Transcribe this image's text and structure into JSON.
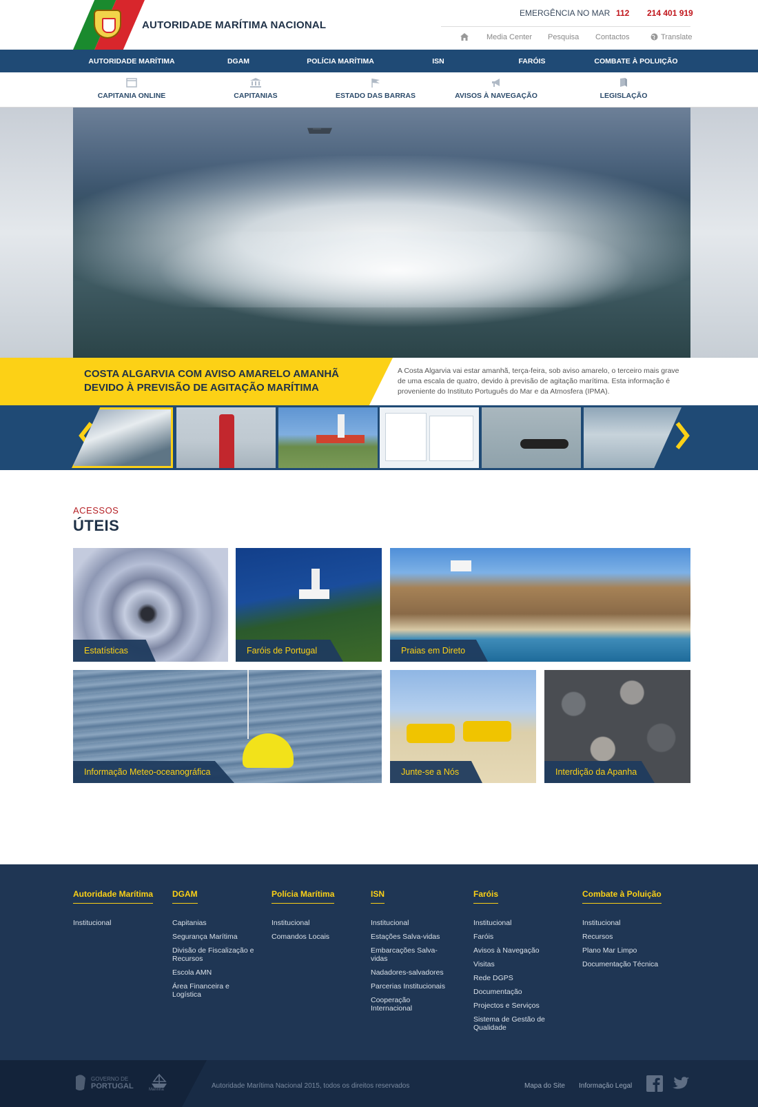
{
  "header": {
    "site_title": "AUTORIDADE MARÍTIMA NACIONAL",
    "emergency_label": "EMERGÊNCIA NO MAR",
    "emergency_number": "112",
    "emergency_phone": "214 401 919",
    "links": [
      "Media Center",
      "Pesquisa",
      "Contactos",
      "Translate"
    ]
  },
  "main_nav": [
    "AUTORIDADE MARÍTIMA",
    "DGAM",
    "POLÍCIA MARÍTIMA",
    "ISN",
    "FARÓIS",
    "COMBATE À POLUIÇÃO"
  ],
  "sub_nav": [
    {
      "label": "CAPITANIA ONLINE",
      "icon": "browser-window-icon"
    },
    {
      "label": "CAPITANIAS",
      "icon": "institution-building-icon"
    },
    {
      "label": "ESTADO DAS BARRAS",
      "icon": "flag-icon"
    },
    {
      "label": "AVISOS À NAVEGAÇÃO",
      "icon": "megaphone-icon"
    },
    {
      "label": "LEGISLAÇÃO",
      "icon": "book-icon"
    }
  ],
  "hero": {
    "headline_line1": "COSTA ALGARVIA COM AVISO AMARELO AMANHÃ",
    "headline_line2": "DEVIDO À PREVISÃO DE AGITAÇÃO MARÍTIMA",
    "description": "A Costa Algarvia vai estar amanhã, terça-feira, sob aviso amarelo, o terceiro mais grave de uma escala de quatro, devido à previsão de agitação marítima. Esta informação é proveniente do Instituto Português do Mar e da Atmosfera (IPMA)."
  },
  "carousel": {
    "thumbnails": [
      "wave-thumbnail",
      "red-buoy-thumbnail",
      "lighthouse-thumbnail",
      "website-screens-thumbnail",
      "rib-boat-thumbnail",
      "fog-ship-helicopter-thumbnail"
    ],
    "active_index": 0
  },
  "section": {
    "kicker": "ACESSOS",
    "title": "ÚTEIS"
  },
  "tiles": [
    "Estatísticas",
    "Faróis de Portugal",
    "Praias em Direto",
    "Informação Meteo-oceanográfica",
    "Junte-se a Nós",
    "Interdição da Apanha"
  ],
  "footer": {
    "columns": [
      {
        "heading": "Autoridade Marítima",
        "links": [
          "Institucional"
        ]
      },
      {
        "heading": "DGAM",
        "links": [
          "Capitanias",
          "Segurança Marítima",
          "Divisão de Fiscalização e Recursos",
          "Escola AMN",
          "Área Financeira e Logística"
        ]
      },
      {
        "heading": "Polícia Marítima",
        "links": [
          "Institucional",
          "Comandos Locais"
        ]
      },
      {
        "heading": "ISN",
        "links": [
          "Institucional",
          "Estações Salva-vidas",
          "Embarcações Salva-vidas",
          "Nadadores-salvadores",
          "Parcerias Institucionais",
          "Cooperação Internacional"
        ]
      },
      {
        "heading": "Faróis",
        "links": [
          "Institucional",
          "Faróis",
          "Avisos à Navegação",
          "Visitas",
          "Rede DGPS",
          "Documentação",
          "Projectos e Serviços",
          "Sistema de Gestão de Qualidade"
        ]
      },
      {
        "heading": "Combate à Poluição",
        "links": [
          "Institucional",
          "Recursos",
          "Plano Mar Limpo",
          "Documentação Técnica"
        ]
      }
    ],
    "gov_logo_line1": "GOVERNO DE",
    "gov_logo_line2": "PORTUGAL",
    "marinha_logo": "Marinha",
    "copyright": "Autoridade Marítima Nacional 2015, todos os direitos reservados",
    "sitemap": "Mapa do Site",
    "legal": "Informação Legal"
  },
  "colors": {
    "navy": "#1f4a75",
    "footer_navy": "#1f3654",
    "yellow": "#fcd116",
    "red_accent": "#c0151b"
  }
}
